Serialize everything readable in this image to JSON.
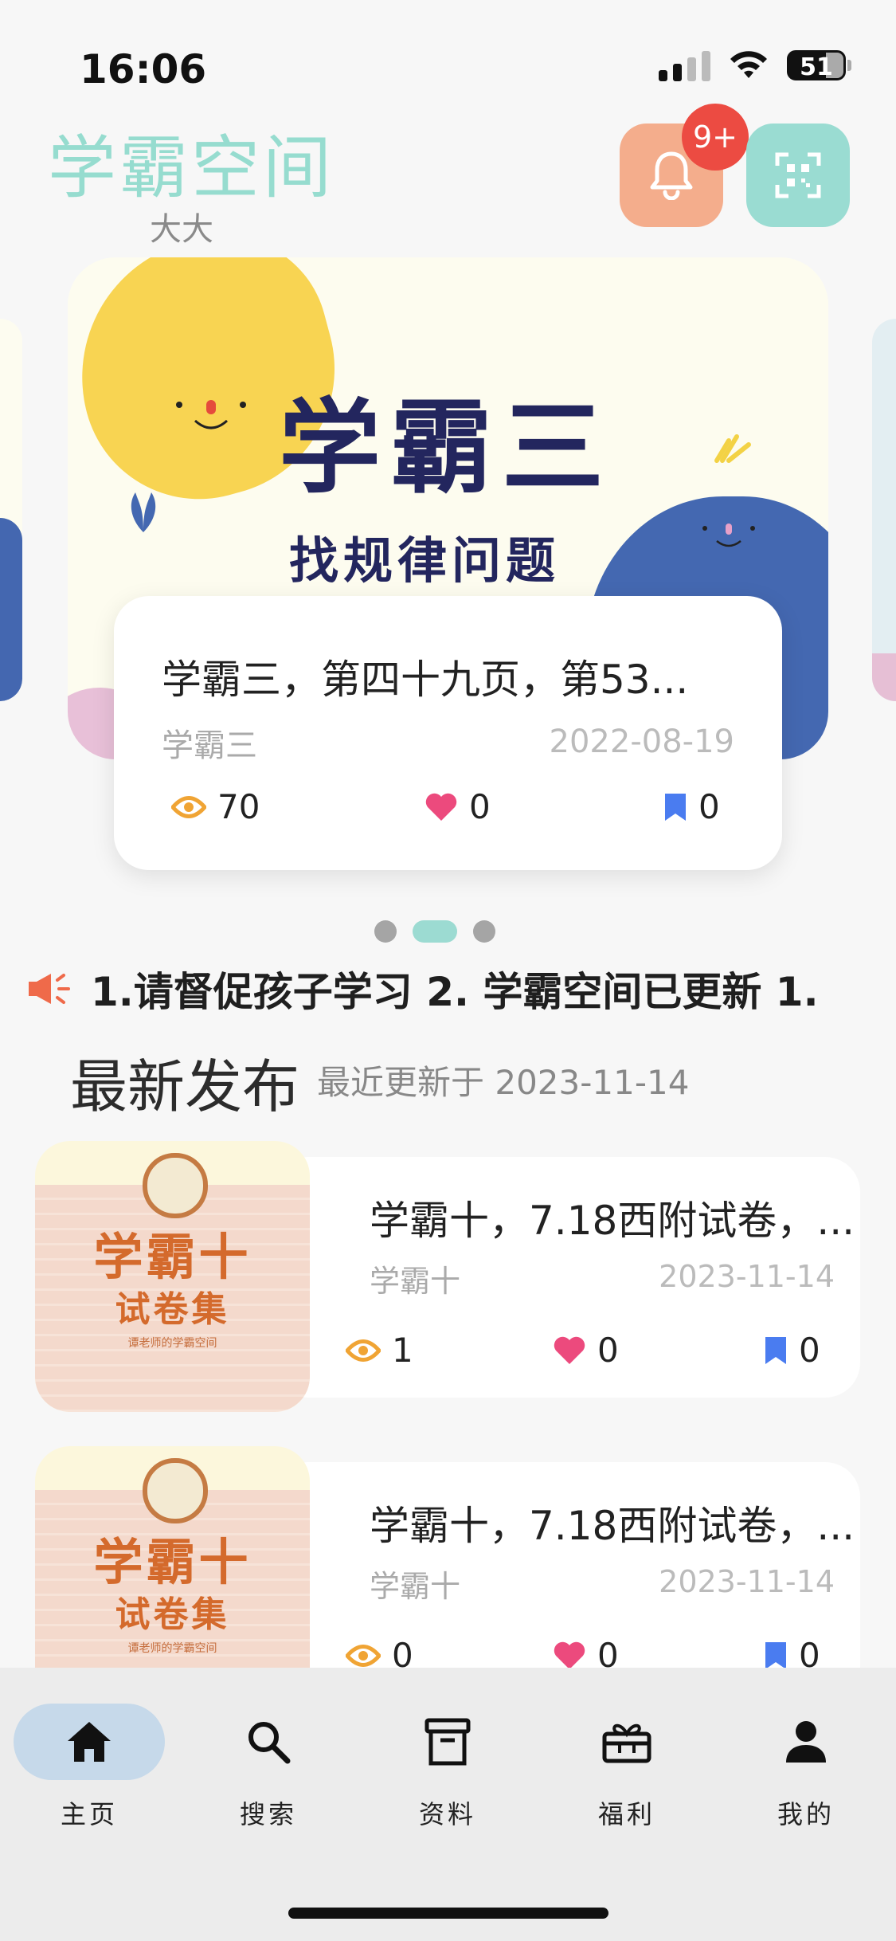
{
  "status_bar": {
    "time": "16:06",
    "battery": "51"
  },
  "header": {
    "title": "学霸空间",
    "subtitle": "大大",
    "notification_badge": "9+"
  },
  "banner": {
    "title": "学霸三",
    "subtitle": "找规律问题",
    "card": {
      "title": "学霸三，第四十九页，第53...",
      "tag": "学霸三",
      "date": "2022-08-19",
      "views": "70",
      "likes": "0",
      "bookmarks": "0"
    },
    "page_count": 3,
    "active_page": 2
  },
  "notice": {
    "text": "1.请督促孩子学习   2. 学霸空间已更新     1."
  },
  "latest": {
    "title": "最新发布",
    "subtitle": "最近更新于 2023-11-14",
    "items": [
      {
        "thumb_title": "学霸十",
        "thumb_sub": "试卷集",
        "thumb_small": "谭老师的学霸空间",
        "title": "学霸十，7.18西附试卷，...",
        "tag": "学霸十",
        "date": "2023-11-14",
        "views": "1",
        "likes": "0",
        "bookmarks": "0"
      },
      {
        "thumb_title": "学霸十",
        "thumb_sub": "试卷集",
        "thumb_small": "谭老师的学霸空间",
        "title": "学霸十，7.18西附试卷，...",
        "tag": "学霸十",
        "date": "2023-11-14",
        "views": "0",
        "likes": "0",
        "bookmarks": "0"
      }
    ]
  },
  "tabs": [
    {
      "label": "主页",
      "icon": "home-icon",
      "active": true
    },
    {
      "label": "搜索",
      "icon": "search-icon",
      "active": false
    },
    {
      "label": "资料",
      "icon": "archive-icon",
      "active": false
    },
    {
      "label": "福利",
      "icon": "gift-icon",
      "active": false
    },
    {
      "label": "我的",
      "icon": "user-icon",
      "active": false
    }
  ],
  "colors": {
    "accent_mint": "#96dccf",
    "bell_orange": "#f4ad8c",
    "badge_red": "#ec4b42",
    "eye_orange": "#f0a434",
    "heart_pink": "#ec4a7d",
    "bookmark_blue": "#4a7cf0"
  }
}
